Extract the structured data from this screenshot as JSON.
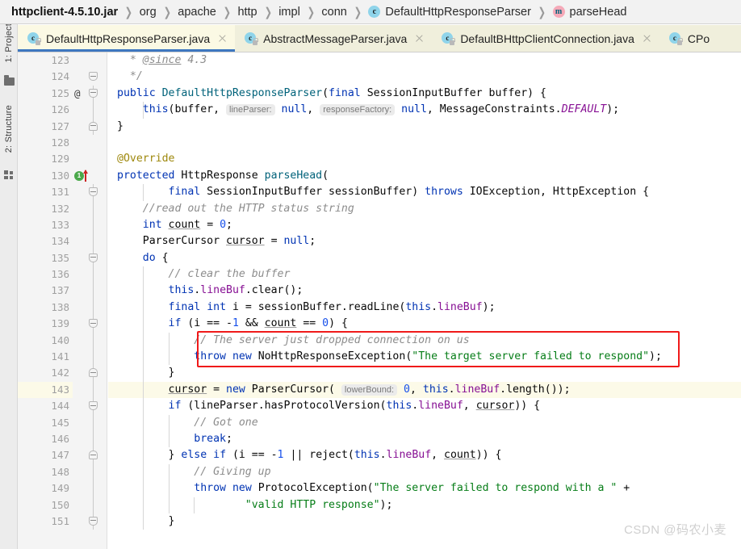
{
  "breadcrumb": {
    "items": [
      {
        "label": "httpclient-4.5.10.jar",
        "icon": "",
        "bold": true
      },
      {
        "label": "org",
        "icon": "",
        "bold": false
      },
      {
        "label": "apache",
        "icon": "",
        "bold": false
      },
      {
        "label": "http",
        "icon": "",
        "bold": false
      },
      {
        "label": "impl",
        "icon": "",
        "bold": false
      },
      {
        "label": "conn",
        "icon": "",
        "bold": false
      },
      {
        "label": "DefaultHttpResponseParser",
        "icon": "c",
        "bold": false
      },
      {
        "label": "parseHead",
        "icon": "m",
        "bold": false
      }
    ],
    "separator": "❯"
  },
  "tool_stripe": {
    "project_label": "1: Project",
    "structure_label": "2: Structure",
    "folder_icon": "folder-icon",
    "structure_icon": "structure-icon"
  },
  "tabs": [
    {
      "label": "DefaultHttpResponseParser.java",
      "icon": "c",
      "active": true,
      "closable": true
    },
    {
      "label": "AbstractMessageParser.java",
      "icon": "c",
      "active": false,
      "closable": true
    },
    {
      "label": "DefaultBHttpClientConnection.java",
      "icon": "c",
      "active": false,
      "closable": true
    },
    {
      "label": "CPo",
      "icon": "c",
      "active": false,
      "closable": false
    }
  ],
  "editor": {
    "first_line": 123,
    "current_line": 143,
    "gutter": {
      "override_marker_line": 130,
      "override_badge": "1",
      "annotation_marker_line": 125,
      "annotation_marker": "@",
      "fold_start_lines": [
        124,
        125,
        131,
        135,
        139,
        144,
        151
      ],
      "fold_end_lines": [
        127,
        142,
        147
      ]
    },
    "lines": [
      {
        "n": 123,
        "html": "  <span class='doc'>* </span><span class='doctag'>@since</span><span class='doc'> 4.3</span>",
        "indents": []
      },
      {
        "n": 124,
        "html": "  <span class='doc'>*/</span>",
        "indents": []
      },
      {
        "n": 125,
        "html": "<span class='kw'>public</span> <span class='mth'>DefaultHttpResponseParser</span>(<span class='kw'>final</span> SessionInputBuffer buffer) {",
        "indents": []
      },
      {
        "n": 126,
        "html": "    <span class='kw'>this</span>(buffer, <span class='hint'>lineParser:</span> <span class='kw'>null</span>, <span class='hint'>responseFactory:</span> <span class='kw'>null</span>, MessageConstraints.<span class='stat'>DEFAULT</span>);",
        "indents": [
          1
        ]
      },
      {
        "n": 127,
        "html": "}",
        "indents": []
      },
      {
        "n": 128,
        "html": "",
        "indents": []
      },
      {
        "n": 129,
        "html": "<span class='anno'>@Override</span>",
        "indents": []
      },
      {
        "n": 130,
        "html": "<span class='kw'>protected</span> HttpResponse <span class='mth'>parseHead</span>(",
        "indents": []
      },
      {
        "n": 131,
        "html": "        <span class='kw'>final</span> SessionInputBuffer sessionBuffer) <span class='kw'>throws</span> IOException, HttpException {",
        "indents": [
          1
        ]
      },
      {
        "n": 132,
        "html": "    <span class='cmt'>//read out the HTTP status string</span>",
        "indents": []
      },
      {
        "n": 133,
        "html": "    <span class='kw'>int</span> <span class='ul'>count</span> = <span class='num'>0</span>;",
        "indents": []
      },
      {
        "n": 134,
        "html": "    ParserCursor <span class='ul'>cursor</span> = <span class='kw'>null</span>;",
        "indents": []
      },
      {
        "n": 135,
        "html": "    <span class='kw'>do</span> {",
        "indents": []
      },
      {
        "n": 136,
        "html": "        <span class='cmt'>// clear the buffer</span>",
        "indents": [
          1
        ]
      },
      {
        "n": 137,
        "html": "        <span class='kw'>this</span>.<span class='fld'>lineBuf</span>.clear();",
        "indents": [
          1
        ]
      },
      {
        "n": 138,
        "html": "        <span class='kw'>final</span> <span class='kw'>int</span> i = sessionBuffer.readLine(<span class='kw'>this</span>.<span class='fld'>lineBuf</span>);",
        "indents": [
          1
        ]
      },
      {
        "n": 139,
        "html": "        <span class='kw'>if</span> (i == -<span class='num'>1</span> &amp;&amp; <span class='ul'>count</span> == <span class='num'>0</span>) {",
        "indents": [
          1
        ]
      },
      {
        "n": 140,
        "html": "            <span class='cmt'>// The server just dropped connection on us</span>",
        "indents": [
          1,
          2
        ]
      },
      {
        "n": 141,
        "html": "            <span class='kw'>throw</span> <span class='kw'>new</span> NoHttpResponseException(<span class='str'>\"The target server failed to respond\"</span>);",
        "indents": [
          1,
          2
        ]
      },
      {
        "n": 142,
        "html": "        }",
        "indents": [
          1
        ]
      },
      {
        "n": 143,
        "html": "        <span class='ul'>cursor</span> = <span class='kw'>new</span> ParserCursor( <span class='hint'>lowerBound:</span> <span class='num'>0</span>, <span class='kw'>this</span>.<span class='fld'>lineBuf</span>.length());",
        "indents": [
          1
        ]
      },
      {
        "n": 144,
        "html": "        <span class='kw'>if</span> (lineParser.hasProtocolVersion(<span class='kw'>this</span>.<span class='fld'>lineBuf</span>, <span class='ul'>cursor</span>)) {",
        "indents": [
          1
        ]
      },
      {
        "n": 145,
        "html": "            <span class='cmt'>// Got one</span>",
        "indents": [
          1,
          2
        ]
      },
      {
        "n": 146,
        "html": "            <span class='kw'>break</span>;",
        "indents": [
          1,
          2
        ]
      },
      {
        "n": 147,
        "html": "        } <span class='kw'>else</span> <span class='kw'>if</span> (i == -<span class='num'>1</span> || reject(<span class='kw'>this</span>.<span class='fld'>lineBuf</span>, <span class='ul'>count</span>)) {",
        "indents": [
          1
        ]
      },
      {
        "n": 148,
        "html": "            <span class='cmt'>// Giving up</span>",
        "indents": [
          1,
          2
        ]
      },
      {
        "n": 149,
        "html": "            <span class='kw'>throw</span> <span class='kw'>new</span> ProtocolException(<span class='str'>\"The server failed to respond with a \"</span> +",
        "indents": [
          1,
          2
        ]
      },
      {
        "n": 150,
        "html": "                    <span class='str'>\"valid HTTP response\"</span>);",
        "indents": [
          1,
          2,
          3
        ]
      },
      {
        "n": 151,
        "html": "        }",
        "indents": [
          1
        ]
      }
    ]
  },
  "annotation_box": {
    "label": "red-highlight-box",
    "color": "#f01a1a",
    "covers_lines": [
      140,
      141
    ]
  },
  "watermark": {
    "text": "CSDN @码农小麦"
  },
  "colors": {
    "keyword": "#0033b3",
    "string": "#067d17",
    "comment": "#8c8c8c",
    "number": "#1750eb",
    "field": "#871094",
    "annotation": "#9e880d",
    "method": "#00627a",
    "tab_active_bg": "#fbf9e4",
    "tab_bar_bg": "#f0efdc",
    "tab_underline": "#3e77c0",
    "current_line_bg": "#fcfae8",
    "gutter_bg": "#f4f4f4",
    "breadcrumb_bg": "#f2f2f2"
  }
}
